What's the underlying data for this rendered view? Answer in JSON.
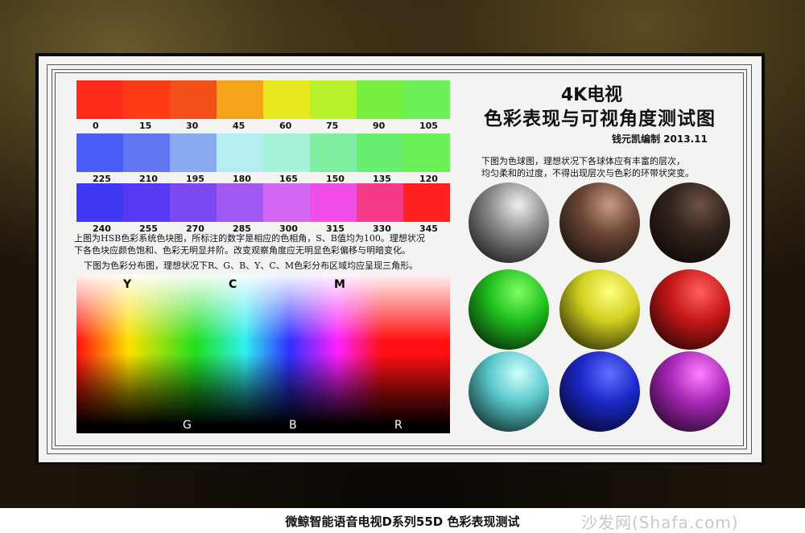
{
  "hue_rows": [
    {
      "colors": [
        "#ff2a1a",
        "#ff3a14",
        "#f25018",
        "#f6a31c",
        "#e8e81e",
        "#b8f22a",
        "#78f040",
        "#6cf058"
      ],
      "labels": [
        "0",
        "15",
        "30",
        "45",
        "60",
        "75",
        "90",
        "105"
      ]
    },
    {
      "colors": [
        "#4a5cf6",
        "#6076f2",
        "#8aaaf0",
        "#b4eef0",
        "#a4f2d8",
        "#80f0a0",
        "#68ee6e",
        "#6cf058"
      ],
      "labels": [
        "225",
        "210",
        "195",
        "180",
        "165",
        "150",
        "135",
        "120"
      ]
    },
    {
      "colors": [
        "#4038f2",
        "#5838f0",
        "#7c48f2",
        "#a05af2",
        "#d268f4",
        "#f04ce6",
        "#f43a86",
        "#ff2020"
      ],
      "labels": [
        "240",
        "255",
        "270",
        "285",
        "300",
        "315",
        "330",
        "345"
      ]
    }
  ],
  "hsb_desc": [
    "上图为HSB色彩系统色块图，所标注的数字是相应的色相角，S、B值均为100。理想状况",
    "下各色块应颜色饱和、色彩无明显并阶。改变观察角度应无明显色彩偏移与明暗变化。"
  ],
  "dist_desc": "下图为色彩分布图，理想状况下R、G、B、Y、C、M色彩分布区域均应呈现三角形。",
  "dist_labels_top": [
    {
      "t": "Y",
      "c": "#e02020"
    },
    {
      "t": "C",
      "c": "#e02020"
    },
    {
      "t": "M",
      "c": "#e02020"
    }
  ],
  "dist_labels_bottom": [
    "G",
    "B",
    "R"
  ],
  "title_line1": "4K电视",
  "title_line2": "色彩表现与可视角度测试图",
  "author": "钱元凯编制  2013.11",
  "sphere_desc": [
    "下图为色球图，理想状况下各球体应有丰富的层次，",
    "均匀柔和的过度，不得出现层次与色彩的环带状突变。"
  ],
  "spheres": [
    {
      "name": "gray",
      "light": "#f0f0f0",
      "mid": "#8a8a8a",
      "dark": "#0a0a0a"
    },
    {
      "name": "brown",
      "light": "#c89a84",
      "mid": "#6a4636",
      "dark": "#0c0806"
    },
    {
      "name": "dark-brown",
      "light": "#6e5246",
      "mid": "#33241c",
      "dark": "#050303"
    },
    {
      "name": "green",
      "light": "#80ff60",
      "mid": "#20c020",
      "dark": "#021202"
    },
    {
      "name": "yellow",
      "light": "#ffff80",
      "mid": "#d2d020",
      "dark": "#141402"
    },
    {
      "name": "red",
      "light": "#ff6060",
      "mid": "#c81818",
      "dark": "#140202"
    },
    {
      "name": "cyan",
      "light": "#d0ffff",
      "mid": "#5ac8cc",
      "dark": "#041414"
    },
    {
      "name": "blue",
      "light": "#6070ff",
      "mid": "#1c28c8",
      "dark": "#020214"
    },
    {
      "name": "magenta",
      "light": "#ff80ff",
      "mid": "#a828b8",
      "dark": "#120214"
    }
  ],
  "caption": "微鲸智能语音电视D系列55D 色彩表现测试",
  "watermark": "沙发网(Shafa.com)"
}
